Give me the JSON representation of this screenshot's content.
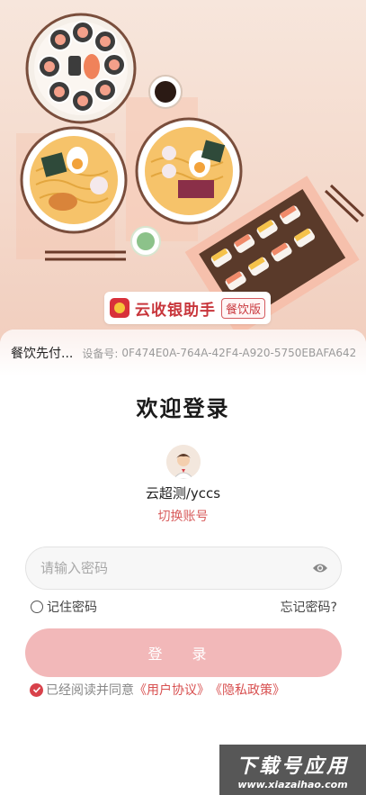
{
  "brand": {
    "name": "云收银助手",
    "tag": "餐饮版"
  },
  "store": {
    "name": "餐饮先付...",
    "device_label": "设备号:",
    "device_id": "0F474E0A-764A-42F4-A920-5750EBAFA642"
  },
  "login": {
    "title": "欢迎登录",
    "username": "云超测/yccs",
    "switch_account": "切换账号",
    "password_placeholder": "请输入密码",
    "password_value": "",
    "remember_password": "记住密码",
    "forgot_password": "忘记密码?",
    "login_button": "登 录"
  },
  "agreement": {
    "prefix": "已经阅读并同意",
    "user_agreement": "《用户协议》",
    "privacy_policy": "《隐私政策》",
    "checked": true
  },
  "watermark": {
    "big": "下载号应用",
    "small": "www.xiazaihao.com"
  },
  "colors": {
    "accent": "#d85d5d",
    "button": "#f2b8b9",
    "brand_red": "#c8363c"
  },
  "icons": {
    "password_toggle": "eye-icon",
    "agree_check": "checkmark-icon"
  }
}
